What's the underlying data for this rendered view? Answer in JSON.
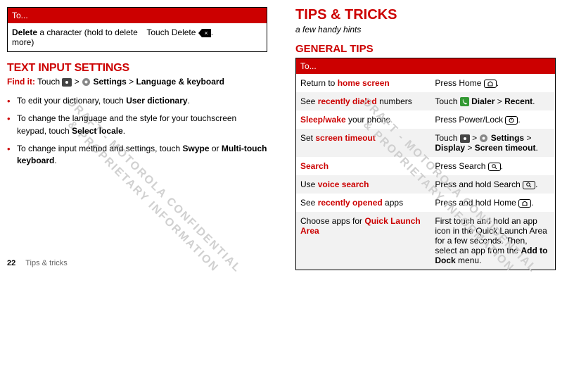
{
  "left": {
    "table1": {
      "header": "To...",
      "row": {
        "action_pre": "Delete",
        "action_post": " a character (hold to delete more)",
        "instruction_pre": "Touch Delete ",
        "instruction_post": "."
      }
    },
    "section_title": "TEXT INPUT SETTINGS",
    "findit_label": "Find it:",
    "findit_touch": " Touch ",
    "findit_sep": " > ",
    "findit_settings": "Settings",
    "findit_langkb": "Language & keyboard",
    "bullets": [
      {
        "pre": "To edit your dictionary, touch ",
        "b1": "User dictionary",
        "post": "."
      },
      {
        "pre": "To change the language and the style for your touchscreen keypad, touch ",
        "b1": "Select locale",
        "post": "."
      },
      {
        "pre": "To change input method and settings, touch ",
        "b1": "Swype",
        "mid": " or ",
        "b2": "Multi-touch keyboard",
        "post": "."
      }
    ]
  },
  "right": {
    "chapter_title": "TIPS & TRICKS",
    "subtitle": "a few handy hints",
    "sub_title": "GENERAL TIPS",
    "table_header": "To...",
    "rows": [
      {
        "alt": false,
        "left_pre": "Return to ",
        "left_red": "home screen",
        "left_post": "",
        "right_pre": "Press Home ",
        "right_icon": "home",
        "right_post": "."
      },
      {
        "alt": true,
        "left_pre": "See ",
        "left_red": "recently dialed",
        "left_post": " numbers",
        "right_pre": "Touch ",
        "right_icon": "dialer",
        "right_bold1": "Dialer",
        "right_mid": " > ",
        "right_bold2": "Recent",
        "right_post": "."
      },
      {
        "alt": false,
        "left_red": "Sleep/wake",
        "left_post": " your phone",
        "right_pre": "Press Power/Lock ",
        "right_icon": "power",
        "right_post": "."
      },
      {
        "alt": true,
        "left_pre": "Set ",
        "left_red": "screen timeout",
        "right_pre": "Touch ",
        "right_icon": "home-small",
        "right_sep1": " > ",
        "right_icon2": "settings",
        "right_bold1": "Settings",
        "right_sep2": " > ",
        "right_bold2": "Display",
        "right_sep3": " > ",
        "right_bold3": "Screen timeout",
        "right_post": "."
      },
      {
        "alt": false,
        "left_red": "Search",
        "right_pre": "Press Search ",
        "right_icon": "search",
        "right_post": "."
      },
      {
        "alt": true,
        "left_pre": "Use ",
        "left_red": "voice search",
        "right_pre": "Press and hold Search ",
        "right_icon": "search",
        "right_post": "."
      },
      {
        "alt": false,
        "left_pre": "See ",
        "left_red": "recently opened",
        "left_post": " apps",
        "right_pre": "Press and hold Home ",
        "right_icon": "home",
        "right_post": "."
      },
      {
        "alt": true,
        "left_pre": "Choose apps for ",
        "left_red": "Quick Launch Area",
        "right_text": "First touch and hold an app icon in the Quick Launch Area for a few seconds. Then, select an app from the ",
        "right_bold1": "Add to Dock",
        "right_post": " menu."
      }
    ]
  },
  "footer": {
    "page": "22",
    "chapter": "Tips & tricks"
  },
  "watermark": "DRAFT - MOTOROLA CONFIDENTIAL\n& PROPRIETARY INFORMATION"
}
